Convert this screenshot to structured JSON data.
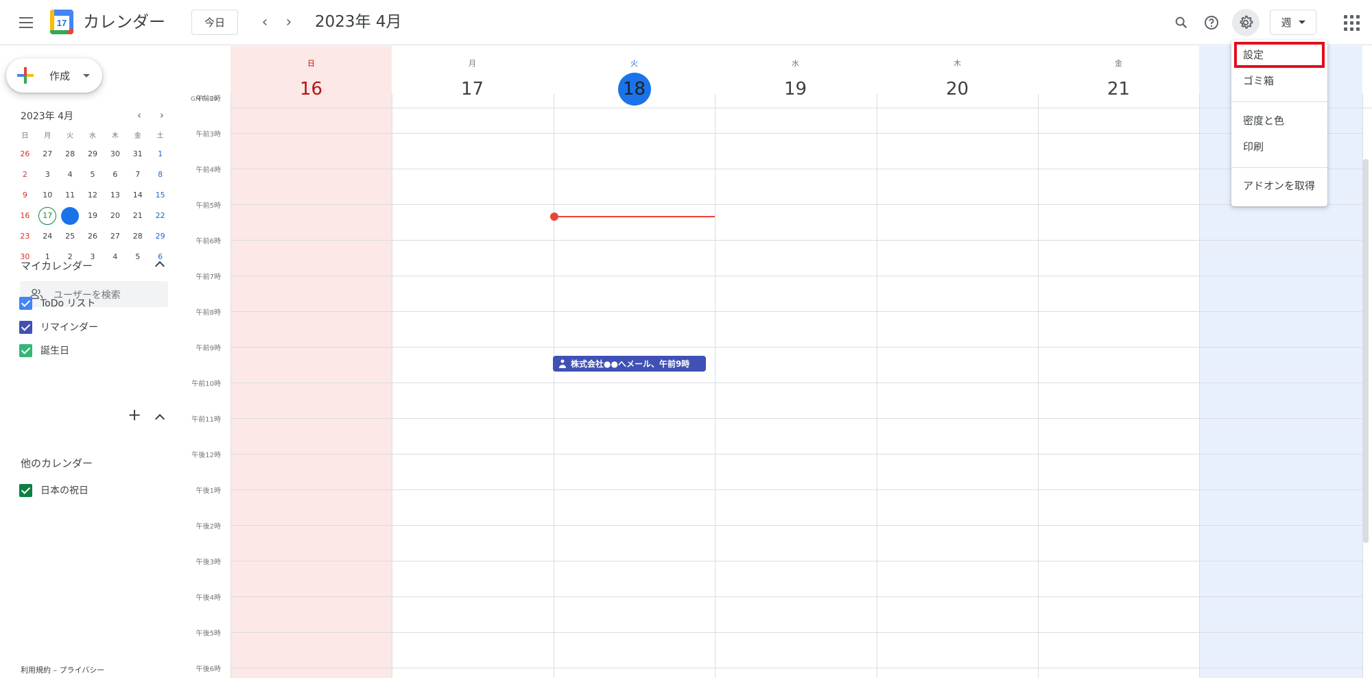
{
  "header": {
    "app_title": "カレンダー",
    "logo_day": "17",
    "today_label": "今日",
    "prev_arrow": "‹",
    "next_arrow": "›",
    "month_title": "2023年 4月",
    "view_label": "週"
  },
  "create": {
    "label": "作成"
  },
  "mini_calendar": {
    "title": "2023年 4月",
    "prev": "‹",
    "next": "›",
    "weekdays": [
      "日",
      "月",
      "火",
      "水",
      "木",
      "金",
      "土"
    ],
    "weeks": [
      [
        "26",
        "27",
        "28",
        "29",
        "30",
        "31",
        "1"
      ],
      [
        "2",
        "3",
        "4",
        "5",
        "6",
        "7",
        "8"
      ],
      [
        "9",
        "10",
        "11",
        "12",
        "13",
        "14",
        "15"
      ],
      [
        "16",
        "17",
        "18",
        "19",
        "20",
        "21",
        "22"
      ],
      [
        "23",
        "24",
        "25",
        "26",
        "27",
        "28",
        "29"
      ],
      [
        "30",
        "1",
        "2",
        "3",
        "4",
        "5",
        "6"
      ]
    ],
    "today": "17",
    "selected": "18"
  },
  "people_search": {
    "placeholder": "ユーザーを検索"
  },
  "my_calendars": {
    "title": "マイカレンダー",
    "items": [
      {
        "label": "ToDo リスト",
        "color": "#4285f4"
      },
      {
        "label": "リマインダー",
        "color": "#3f51b5"
      },
      {
        "label": "誕生日",
        "color": "#33b679"
      }
    ]
  },
  "other_calendars": {
    "title": "他のカレンダー",
    "add_symbol": "+",
    "items": [
      {
        "label": "日本の祝日",
        "color": "#0b8043"
      }
    ]
  },
  "footer": {
    "links": "利用規約 – プライバシー"
  },
  "week": {
    "timezone": "GMT+09",
    "days": [
      {
        "dow": "日",
        "num": "16",
        "type": "sunday"
      },
      {
        "dow": "月",
        "num": "17",
        "type": "normal"
      },
      {
        "dow": "火",
        "num": "18",
        "type": "today"
      },
      {
        "dow": "水",
        "num": "19",
        "type": "normal"
      },
      {
        "dow": "木",
        "num": "20",
        "type": "normal"
      },
      {
        "dow": "金",
        "num": "21",
        "type": "normal"
      },
      {
        "dow": "",
        "num": "",
        "type": "saturday"
      }
    ],
    "hours": [
      "午前2時",
      "午前3時",
      "午前4時",
      "午前5時",
      "午前6時",
      "午前7時",
      "午前8時",
      "午前9時",
      "午前10時",
      "午前11時",
      "午後12時",
      "午後1時",
      "午後2時",
      "午後3時",
      "午後4時",
      "午後5時",
      "午後6時"
    ],
    "event": {
      "title": "株式会社●●へメール、午前9時"
    }
  },
  "settings_menu": {
    "items": [
      "設定",
      "ゴミ箱",
      "密度と色",
      "印刷",
      "アドオンを取得"
    ],
    "highlighted": "設定"
  },
  "colors": {
    "accent": "#1a73e8",
    "sunday_bg": "#fce8e6",
    "saturday_bg": "#e8f0fe",
    "now_line": "#ea4335",
    "highlight_border": "#e30d1b"
  }
}
